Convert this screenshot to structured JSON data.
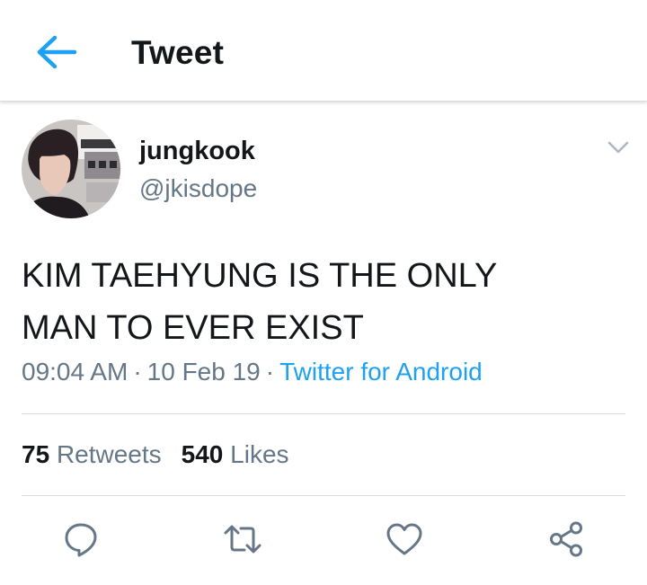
{
  "header": {
    "title": "Tweet",
    "back_icon": "arrow-left-icon",
    "accent_color": "#1da1f2"
  },
  "tweet": {
    "display_name": "jungkook",
    "handle": "@jkisdope",
    "text_line1": "KIM TAEHYUNG IS THE ONLY",
    "text_line2": "MAN TO EVER EXIST",
    "time": "09:04 AM",
    "date": "10 Feb 19",
    "separator": "·",
    "source": "Twitter for Android",
    "retweet_count": "75",
    "retweet_label": "Retweets",
    "like_count": "540",
    "like_label": "Likes"
  },
  "actions": {
    "reply_icon": "reply-bubble-icon",
    "retweet_icon": "retweet-icon",
    "like_icon": "heart-icon",
    "share_icon": "share-icon"
  },
  "colors": {
    "text": "#14171a",
    "secondary": "#657786",
    "link": "#1da1f2",
    "divider": "#d8dde1"
  }
}
